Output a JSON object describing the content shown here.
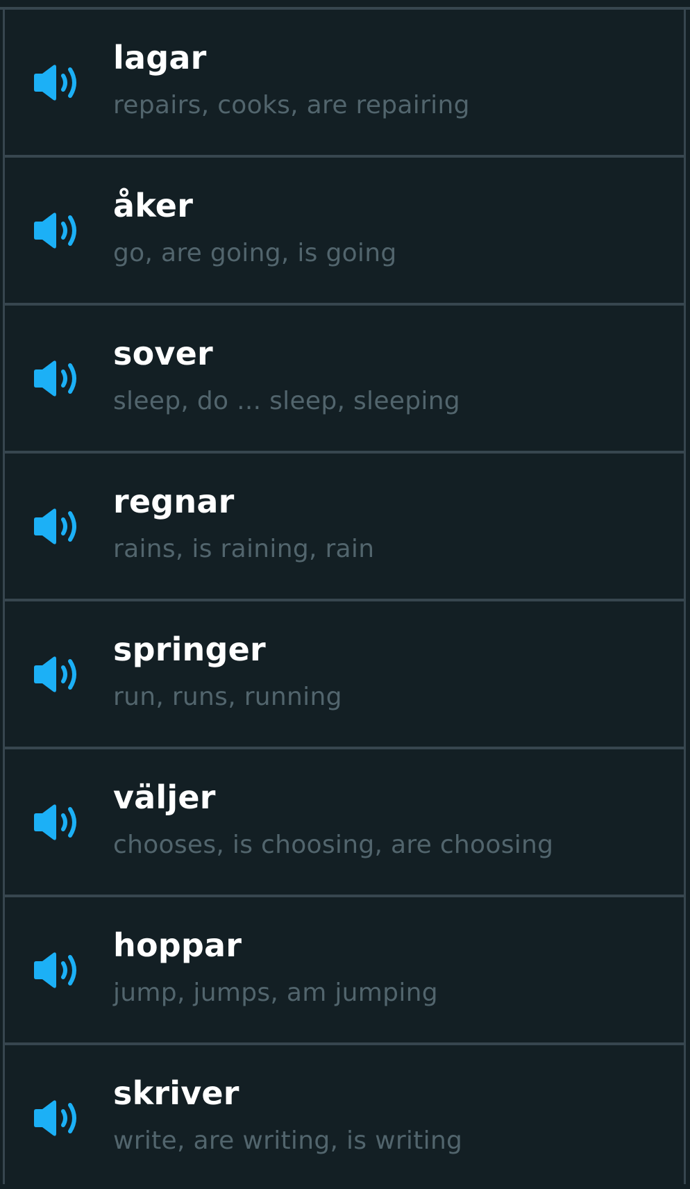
{
  "accent_color": "#1cb0f6",
  "icon": "speaker-icon",
  "words": [
    {
      "word": "lagar",
      "translation": "repairs, cooks, are repairing"
    },
    {
      "word": "åker",
      "translation": "go, are going, is going"
    },
    {
      "word": "sover",
      "translation": "sleep, do ... sleep, sleeping"
    },
    {
      "word": "regnar",
      "translation": "rains, is raining, rain"
    },
    {
      "word": "springer",
      "translation": "run, runs, running"
    },
    {
      "word": "väljer",
      "translation": "chooses, is choosing, are choosing"
    },
    {
      "word": "hoppar",
      "translation": "jump, jumps, am jumping"
    },
    {
      "word": "skriver",
      "translation": "write, are writing, is writing"
    }
  ]
}
